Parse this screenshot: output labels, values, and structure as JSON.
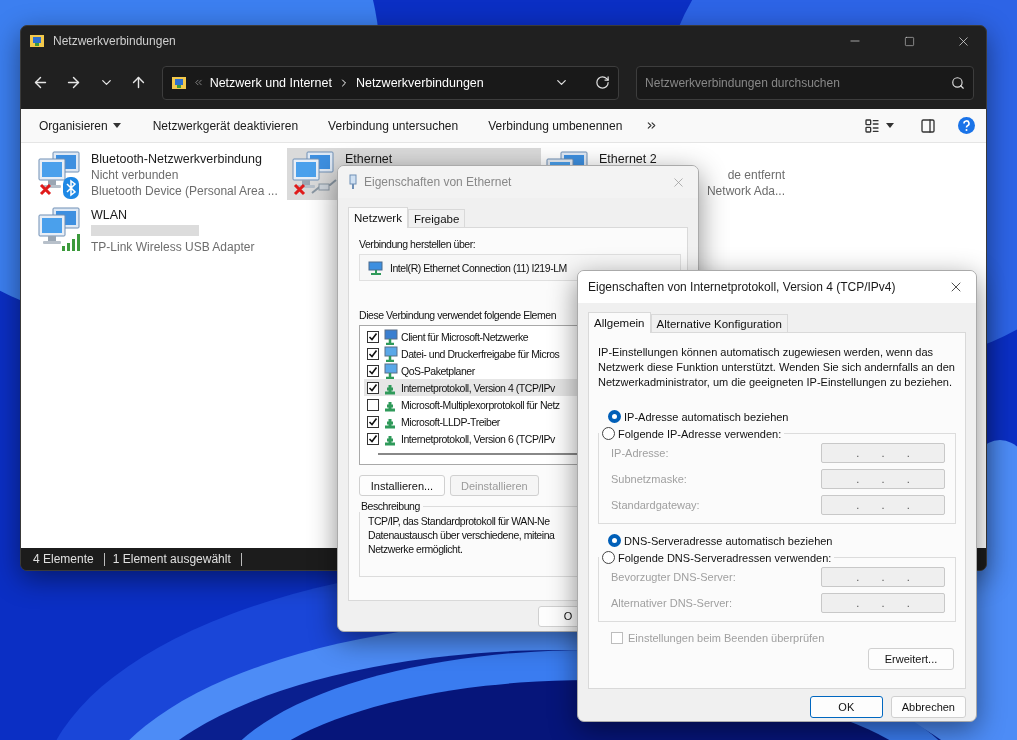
{
  "explorer": {
    "title": "Netzwerkverbindungen",
    "breadcrumb": [
      "Netzwerk und Internet",
      "Netzwerkverbindungen"
    ],
    "search": {
      "placeholder": "Netzwerkverbindungen durchsuchen"
    },
    "toolbar": [
      {
        "label": "Organisieren",
        "kind": "menu"
      },
      {
        "label": "Netzwerkgerät deaktivieren",
        "kind": "command"
      },
      {
        "label": "Verbindung untersuchen",
        "kind": "command"
      },
      {
        "label": "Verbindung umbenennen",
        "kind": "command"
      }
    ],
    "connections": [
      {
        "name": "Bluetooth-Netzwerkverbindung",
        "details": [
          "Nicht verbunden",
          "Bluetooth Device (Personal Area ..."
        ],
        "kind": "bluetooth",
        "disconnected": true,
        "selected": false
      },
      {
        "name": "Ethernet",
        "kind": "ethernet",
        "disconnected": true,
        "selected": true
      },
      {
        "name": "Ethernet 2",
        "details": [
          "de entfernt",
          "Network Ada..."
        ],
        "kind": "network",
        "disconnected": false,
        "selected": false
      },
      {
        "name": "WLAN",
        "details": [
          "TP-Link Wireless USB Adapter"
        ],
        "kind": "wifi",
        "disconnected": false,
        "selected": false,
        "redacted": true
      }
    ],
    "status_bar": [
      "4 Elemente",
      "1 Element ausgewählt"
    ]
  },
  "ethernet_dialog": {
    "title": "Eigenschaften von Ethernet",
    "tabs": [
      {
        "label": "Netzwerk",
        "selected": true
      },
      {
        "label": "Freigabe",
        "selected": false
      }
    ],
    "connect_label": "Verbindung herstellen über:",
    "adapter": "Intel(R) Ethernet Connection (11) I219-LM",
    "components_label": "Diese Verbindung verwendet folgende Elemen",
    "components": [
      {
        "label": "Client für Microsoft-Netzwerke",
        "kind": "client",
        "checked": true,
        "selected": false
      },
      {
        "label": "Datei- und Druckerfreigabe für Micros",
        "kind": "service",
        "checked": true,
        "selected": false
      },
      {
        "label": "QoS-Paketplaner",
        "kind": "service",
        "checked": true,
        "selected": false
      },
      {
        "label": "Internetprotokoll, Version 4 (TCP/IPv",
        "kind": "protocol",
        "checked": true,
        "selected": true
      },
      {
        "label": "Microsoft-Multiplexorprotokoll für Netz",
        "kind": "protocol",
        "checked": false,
        "selected": false
      },
      {
        "label": "Microsoft-LLDP-Treiber",
        "kind": "protocol",
        "checked": true,
        "selected": false
      },
      {
        "label": "Internetprotokoll, Version 6 (TCP/IPv",
        "kind": "protocol",
        "checked": true,
        "selected": false
      }
    ],
    "buttons": [
      {
        "label": "Installieren...",
        "disabled": false
      },
      {
        "label": "Deinstallieren",
        "disabled": true
      }
    ],
    "description": {
      "title": "Beschreibung",
      "lines": [
        "TCP/IP, das Standardprotokoll für WAN-Ne",
        "Datenaustausch über verschiedene, miteina",
        "Netzwerke ermöglicht."
      ]
    },
    "ok_button": "O"
  },
  "ipv4_dialog": {
    "title": "Eigenschaften von Internetprotokoll, Version 4 (TCP/IPv4)",
    "tabs": [
      {
        "label": "Allgemein",
        "selected": true
      },
      {
        "label": "Alternative Konfiguration",
        "selected": false
      }
    ],
    "intro": "IP-Einstellungen können automatisch zugewiesen werden, wenn das Netzwerk diese Funktion unterstützt. Wenden Sie sich andernfalls an den Netzwerkadministrator, um die geeigneten IP-Einstellungen zu beziehen.",
    "ip_mode": [
      {
        "label": "IP-Adresse automatisch beziehen",
        "selected": true
      },
      {
        "label": "Folgende IP-Adresse verwenden:",
        "selected": false
      }
    ],
    "ip_fields": [
      {
        "label": "IP-Adresse:",
        "disabled": true,
        "separators": [
          ".",
          ".",
          "."
        ]
      },
      {
        "label": "Subnetzmaske:",
        "disabled": true,
        "separators": [
          ".",
          ".",
          "."
        ]
      },
      {
        "label": "Standardgateway:",
        "disabled": true,
        "separators": [
          ".",
          ".",
          "."
        ]
      }
    ],
    "dns_mode": [
      {
        "label": "DNS-Serveradresse automatisch beziehen",
        "selected": true
      },
      {
        "label": "Folgende DNS-Serveradressen verwenden:",
        "selected": false
      }
    ],
    "dns_fields": [
      {
        "label": "Bevorzugter DNS-Server:",
        "disabled": true,
        "separators": [
          ".",
          ".",
          "."
        ]
      },
      {
        "label": "Alternativer DNS-Server:",
        "disabled": true,
        "separators": [
          ".",
          ".",
          "."
        ]
      }
    ],
    "validate_on_exit": {
      "label": "Einstellungen beim Beenden überprüfen",
      "checked": false,
      "disabled": true
    },
    "advanced_button": "Erweitert...",
    "buttons": [
      {
        "label": "OK",
        "default": true
      },
      {
        "label": "Abbrechen",
        "default": false
      }
    ]
  }
}
